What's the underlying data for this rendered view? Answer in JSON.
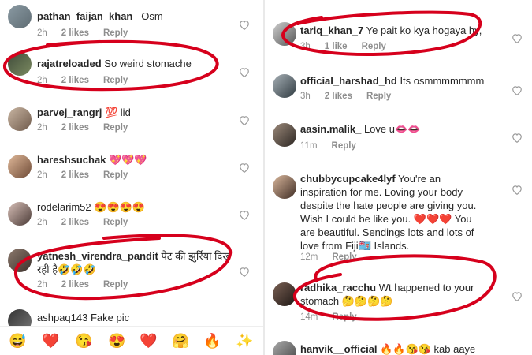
{
  "left": {
    "comments": [
      {
        "user": "pathan_faijan_khan_",
        "text": "Osm",
        "time": "2h",
        "likes": "2 likes",
        "reply": "Reply"
      },
      {
        "user": "rajatreloaded",
        "text": "So weird stomache",
        "time": "2h",
        "likes": "2 likes",
        "reply": "Reply"
      },
      {
        "user": "parvej_rangrj",
        "text": "💯 lid",
        "time": "2h",
        "likes": "2 likes",
        "reply": "Reply"
      },
      {
        "user": "hareshsuchak",
        "text": "💖💖💖",
        "time": "2h",
        "likes": "2 likes",
        "reply": "Reply"
      },
      {
        "user": "rodelarim52",
        "text": "😍😍😍😍",
        "time": "2h",
        "likes": "2 likes",
        "reply": "Reply"
      },
      {
        "user": "yatnesh_virendra_pandit",
        "text": "पेट की झुर्रिया दिख",
        "text2": "रही है🤣🤣🤣",
        "time": "2h",
        "likes": "2 likes",
        "reply": "Reply"
      },
      {
        "user": "ashpaq143",
        "text": "Fake pic"
      }
    ],
    "emoji_bar": [
      "😅",
      "❤️",
      "😘",
      "😍",
      "❤️",
      "🤗",
      "🔥",
      "✨"
    ]
  },
  "right": {
    "comments": [
      {
        "user": "tariq_khan_7",
        "text": "Ye pait ko kya hogaya hy,",
        "time": "3h",
        "likes": "1 like",
        "reply": "Reply"
      },
      {
        "user": "official_harshad_hd",
        "text": "Its osmmmmmmm",
        "time": "3h",
        "likes": "2 likes",
        "reply": "Reply"
      },
      {
        "user": "aasin.malik_",
        "text": "Love u👄👄",
        "time": "11m",
        "reply": "Reply"
      },
      {
        "user": "chubbycupcake4lyf",
        "text": "You're an",
        "lines": [
          "inspiration for me. Loving your body",
          "despite the hate people are giving you.",
          "Wish I could be like you. ❤️❤️❤️ You",
          "are beautiful.  Sendings lots and lots of",
          "love from Fiji🇫🇯 Islands."
        ],
        "time": "12m",
        "reply": "Reply"
      },
      {
        "user": "radhika_racchu",
        "text": "Wt happened to your",
        "line2": "stomach 🤔🤔🤔🤔",
        "time": "14m",
        "reply": "Reply"
      },
      {
        "user": "hanvik__official",
        "text": "🔥🔥😘😘 kab aaye"
      }
    ]
  },
  "colors": {
    "annotation": "#d6001c",
    "meta": "#8e8e8e",
    "text": "#262626"
  }
}
